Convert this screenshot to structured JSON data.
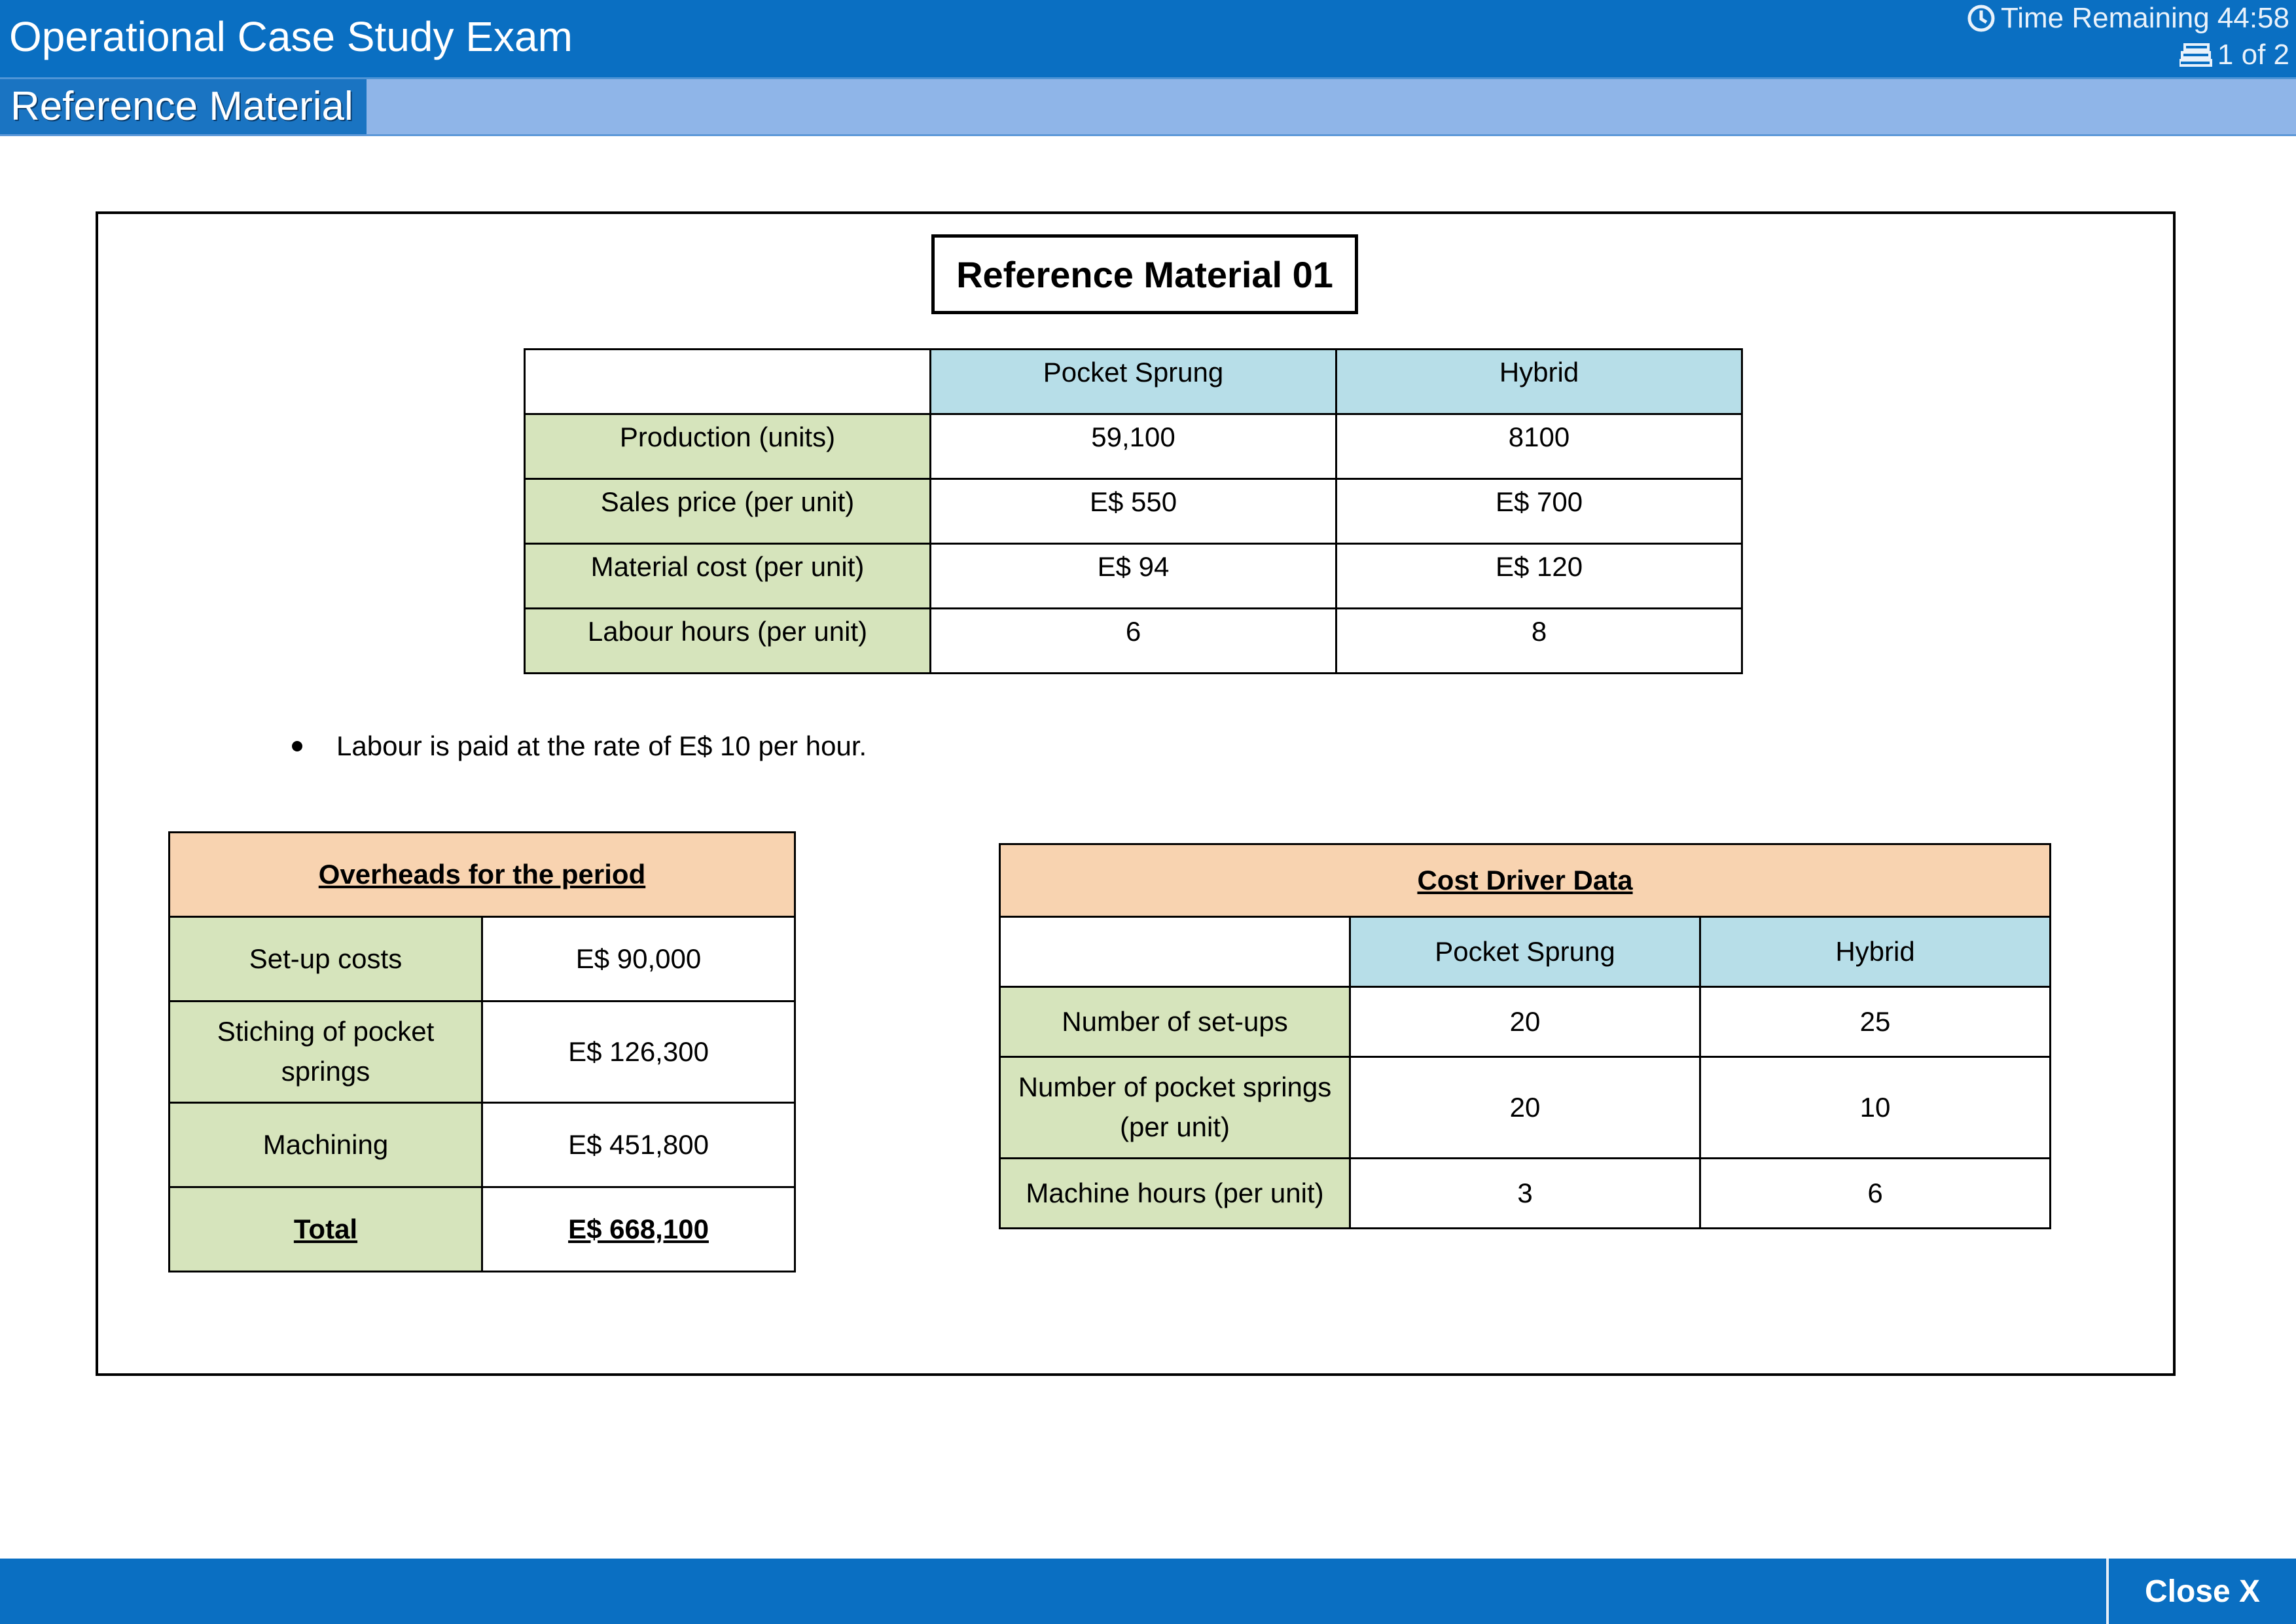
{
  "header": {
    "exam_title": "Operational Case Study Exam",
    "timer_label": "Time Remaining 44:58",
    "page_indicator": "1 of 2",
    "tab_label": "Reference Material",
    "colors": {
      "header_bg": "#0a6fc2",
      "subbar_bg": "#8fb5e8",
      "tab_bg": "#1a74c2"
    },
    "icons": [
      "clock-icon",
      "pages-icon"
    ]
  },
  "document": {
    "title": "Reference Material 01",
    "main_table": {
      "headers": [
        "",
        "Pocket Sprung",
        "Hybrid"
      ],
      "rows": [
        {
          "label": "Production (units)",
          "values": [
            "59,100",
            "8100"
          ]
        },
        {
          "label": "Sales price (per unit)",
          "values": [
            "E$ 550",
            "E$ 700"
          ]
        },
        {
          "label": "Material cost (per unit)",
          "values": [
            "E$ 94",
            "E$ 120"
          ]
        },
        {
          "label": "Labour hours (per unit)",
          "values": [
            "6",
            "8"
          ]
        }
      ]
    },
    "note": "Labour is paid at the rate of E$ 10 per hour.",
    "overheads": {
      "title": "Overheads for the period",
      "rows": [
        {
          "label": "Set-up costs",
          "value": "E$ 90,000"
        },
        {
          "label": "Stiching of pocket springs",
          "value": "E$ 126,300"
        },
        {
          "label": "Machining",
          "value": "E$ 451,800"
        },
        {
          "label": "Total",
          "value": "E$ 668,100"
        }
      ]
    },
    "cost_drivers": {
      "title": "Cost Driver Data",
      "headers": [
        "",
        "Pocket Sprung",
        "Hybrid"
      ],
      "rows": [
        {
          "label": "Number of set-ups",
          "values": [
            "20",
            "25"
          ]
        },
        {
          "label": "Number of pocket springs (per unit)",
          "values": [
            "20",
            "10"
          ]
        },
        {
          "label": "Machine hours (per unit)",
          "values": [
            "3",
            "6"
          ]
        }
      ]
    },
    "colors": {
      "label_cell": "#d6e4bc",
      "header_cell": "#b7dee8",
      "title_cell": "#f8d3b0"
    }
  },
  "footer": {
    "close_label": "Close X"
  }
}
